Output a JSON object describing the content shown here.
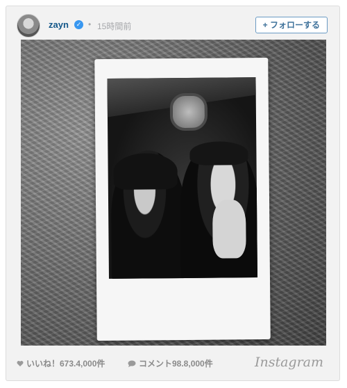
{
  "post": {
    "username": "zayn",
    "timestamp": "15時間前",
    "follow_label": "+ フォローする"
  },
  "stats": {
    "likes_label": "いいね！673.4,000件",
    "comments_label": "コメント98.8,000件"
  },
  "brand": {
    "name": "Instagram"
  },
  "icons": {
    "verified": "check-icon",
    "likes": "heart-icon",
    "comments": "speech-bubble-icon"
  },
  "colors": {
    "username": "#125688",
    "verified": "#3897f0",
    "follow_border": "#6a9ac3",
    "follow_text": "#3f729b",
    "muted_text": "#a5a7aa"
  }
}
